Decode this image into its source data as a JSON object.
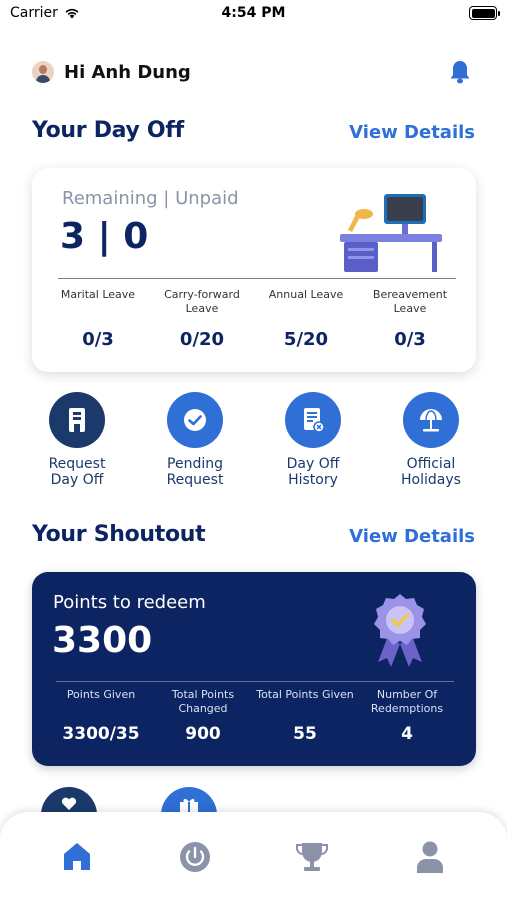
{
  "status": {
    "carrier": "Carrier",
    "time": "4:54 PM"
  },
  "header": {
    "greeting": "Hi Anh Dung"
  },
  "dayoff": {
    "title": "Your Day Off",
    "view_details": "View Details",
    "summary_label": "Remaining | Unpaid",
    "summary_value": "3 | 0",
    "leaves": [
      {
        "label": "Marital Leave",
        "value": "0/3"
      },
      {
        "label": "Carry-forward Leave",
        "value": "0/20"
      },
      {
        "label": "Annual Leave",
        "value": "5/20"
      },
      {
        "label": "Bereavement Leave",
        "value": "0/3"
      }
    ]
  },
  "actions": [
    {
      "label": "Request\nDay Off",
      "icon": "door-icon"
    },
    {
      "label": "Pending\nRequest",
      "icon": "check-icon"
    },
    {
      "label": "Day Off\nHistory",
      "icon": "history-icon"
    },
    {
      "label": "Official\nHolidays",
      "icon": "beach-umbrella-icon"
    }
  ],
  "shoutout": {
    "title": "Your Shoutout",
    "view_details": "View Details",
    "points_label": "Points to redeem",
    "points_value": "3300",
    "stats": [
      {
        "label": "Points Given",
        "value": "3300/35"
      },
      {
        "label": "Total Points Changed",
        "value": "900"
      },
      {
        "label": "Total Points Given",
        "value": "55"
      },
      {
        "label": "Number Of Redemptions",
        "value": "4"
      }
    ]
  },
  "tabs": [
    {
      "name": "home",
      "icon": "home-icon",
      "active": true
    },
    {
      "name": "power",
      "icon": "power-icon",
      "active": false
    },
    {
      "name": "trophy",
      "icon": "trophy-icon",
      "active": false
    },
    {
      "name": "profile",
      "icon": "user-icon",
      "active": false
    }
  ],
  "colors": {
    "primary": "#2f6fd6",
    "navy": "#0c2461",
    "inactive": "#8a93a8"
  }
}
